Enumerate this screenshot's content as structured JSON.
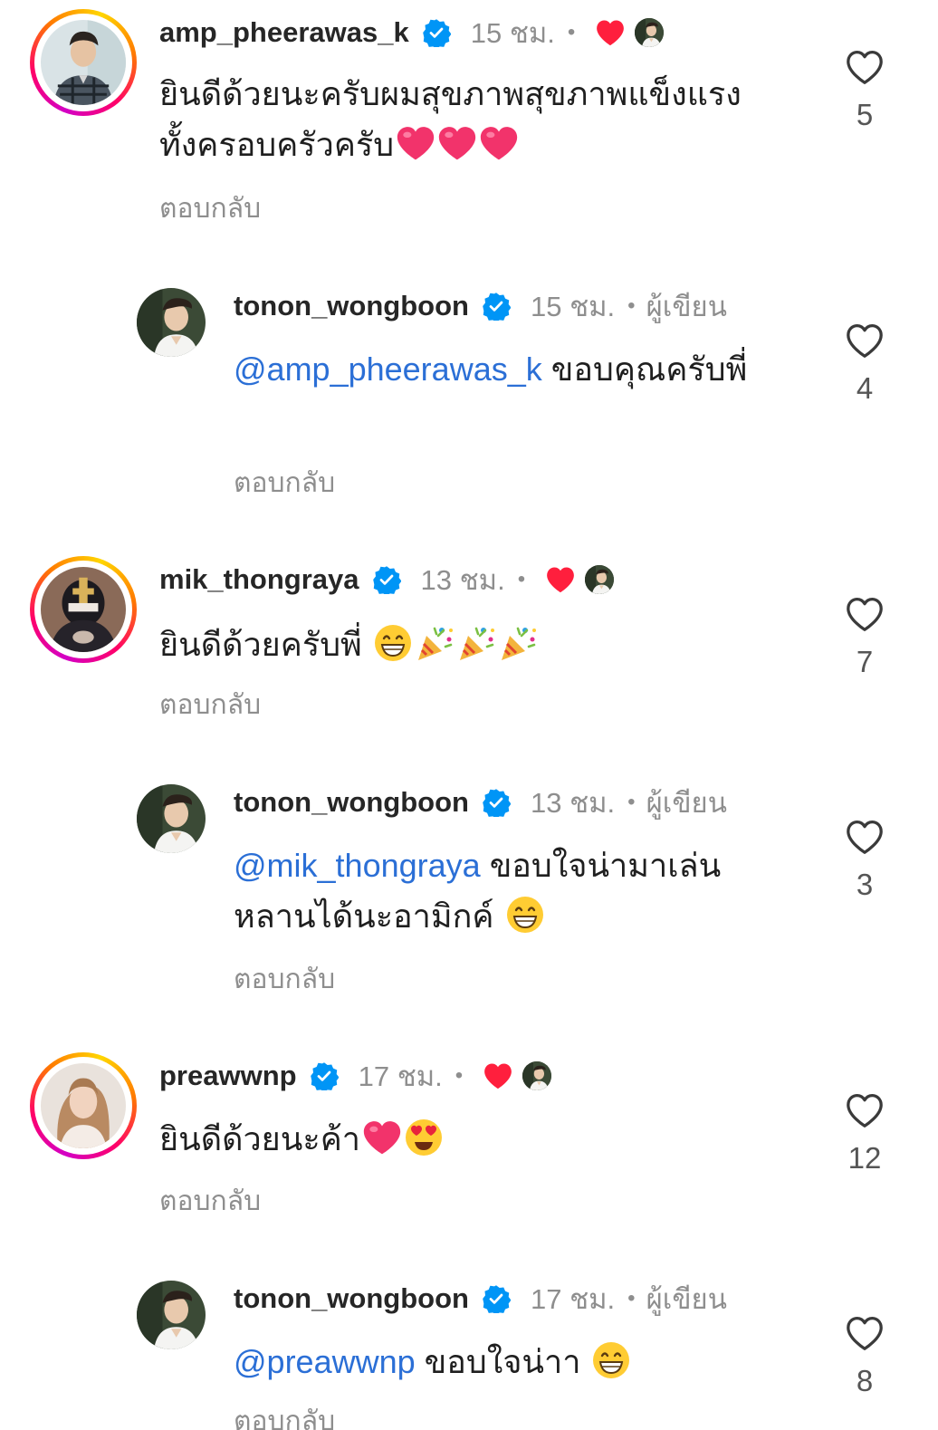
{
  "comments": [
    {
      "username": "amp_pheerawas_k",
      "time": "15 ชม.",
      "text": "ยินดีด้วยนะครับผมสุขภาพสุขภาพแข็งแรงทั้งครอบครัวครับ",
      "reply": "ตอบกลับ",
      "likes": "5",
      "emoji_icons": [
        "heart-emoji",
        "heart-emoji",
        "heart-emoji"
      ]
    },
    {
      "username": "tonon_wongboon",
      "time": "15 ชม.",
      "author_label": "ผู้เขียน",
      "mention": "@amp_pheerawas_k",
      "text": "ขอบคุณครับพี่",
      "reply": "ตอบกลับ",
      "likes": "4"
    },
    {
      "username": "mik_thongraya",
      "time": "13 ชม.",
      "text": "ยินดีด้วยครับพี่",
      "reply": "ตอบกลับ",
      "likes": "7",
      "emoji_icons": [
        "grin-emoji",
        "party-popper-emoji",
        "party-popper-emoji",
        "party-popper-emoji"
      ]
    },
    {
      "username": "tonon_wongboon",
      "time": "13 ชม.",
      "author_label": "ผู้เขียน",
      "mention": "@mik_thongraya",
      "text": "ขอบใจน่ามาเล่นหลานได้นะอามิกค์",
      "reply": "ตอบกลับ",
      "likes": "3",
      "emoji_icons": [
        "grin-emoji"
      ]
    },
    {
      "username": "preawwnp",
      "time": "17 ชม.",
      "text": "ยินดีด้วยนะค้า",
      "reply": "ตอบกลับ",
      "likes": "12",
      "emoji_icons": [
        "heart-emoji",
        "heart-eyes-emoji"
      ]
    },
    {
      "username": "tonon_wongboon",
      "time": "17 ชม.",
      "author_label": "ผู้เขียน",
      "mention": "@preawwnp",
      "text": "ขอบใจน่าา",
      "reply": "ตอบกลับ",
      "likes": "8",
      "emoji_icons": [
        "grin-emoji"
      ]
    }
  ],
  "separator": "•",
  "colors": {
    "mention": "#2b6fd6",
    "verified": "#0095f6",
    "liked_heart": "#ff1f3d",
    "meta_gray": "#8e8e8e"
  }
}
